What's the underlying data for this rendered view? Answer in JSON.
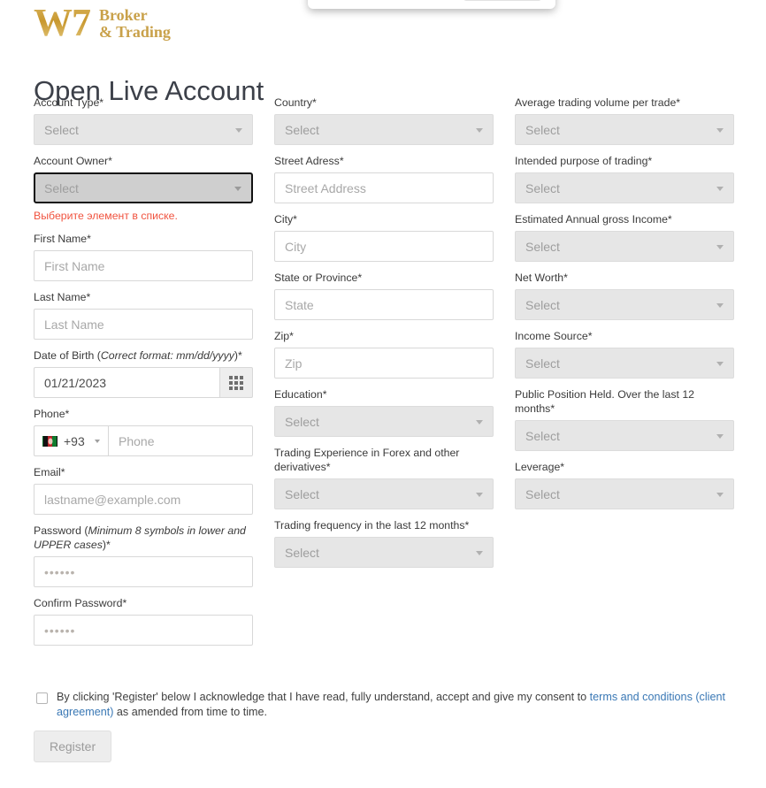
{
  "brand": {
    "mark": "W7",
    "word_line1": "Broker",
    "word_line2": "& Trading",
    "gold": "#c9a14a"
  },
  "page": {
    "title": "Open Live Account"
  },
  "colors": {
    "error": "#f0533f",
    "link": "#3a78b5",
    "select_bg": "#e6e6e6",
    "focus_border": "#111111"
  },
  "select_placeholder": "Select",
  "columns": {
    "left": [
      {
        "key": "account_type",
        "label": "Account Type*",
        "type": "select",
        "value": "Select"
      },
      {
        "key": "account_owner",
        "label": "Account Owner*",
        "type": "select",
        "value": "Select",
        "focused": true,
        "error": "Выберите элемент в списке."
      },
      {
        "key": "first_name",
        "label": "First Name*",
        "type": "text",
        "value": "",
        "placeholder": "First Name"
      },
      {
        "key": "last_name",
        "label": "Last Name*",
        "type": "text",
        "value": "",
        "placeholder": "Last Name"
      },
      {
        "key": "dob",
        "label_prefix": "Date of Birth (",
        "label_em": "Correct format: mm/dd/yyyy",
        "label_suffix": ")*",
        "type": "date",
        "value": "01/21/2023",
        "icon": "calendar-grid-icon"
      },
      {
        "key": "phone",
        "label": "Phone*",
        "type": "phone",
        "country_code": "+93",
        "flag": "afghanistan-flag",
        "value": "",
        "placeholder": "Phone"
      },
      {
        "key": "email",
        "label": "Email*",
        "type": "text",
        "value": "",
        "placeholder": "lastname@example.com"
      },
      {
        "key": "password",
        "label_prefix": "Password (",
        "label_em": "Minimum 8 symbols in lower and UPPER cases",
        "label_suffix": ")*",
        "type": "password",
        "value": "",
        "placeholder": "••••••"
      },
      {
        "key": "confirm_password",
        "label": "Confirm Password*",
        "type": "password",
        "value": "",
        "placeholder": "••••••"
      }
    ],
    "middle": [
      {
        "key": "country",
        "label": "Country*",
        "type": "select",
        "value": "Select"
      },
      {
        "key": "street",
        "label": "Street Adress*",
        "type": "text",
        "value": "",
        "placeholder": "Street Address"
      },
      {
        "key": "city",
        "label": "City*",
        "type": "text",
        "value": "",
        "placeholder": "City"
      },
      {
        "key": "state",
        "label": "State or Province*",
        "type": "text",
        "value": "",
        "placeholder": "State"
      },
      {
        "key": "zip",
        "label": "Zip*",
        "type": "text",
        "value": "",
        "placeholder": "Zip"
      },
      {
        "key": "education",
        "label": "Education*",
        "type": "select",
        "value": "Select"
      },
      {
        "key": "trading_experience",
        "label": "Trading Experience in Forex and other derivatives*",
        "type": "select",
        "value": "Select"
      },
      {
        "key": "trading_frequency",
        "label": "Trading frequency in the last 12 months*",
        "type": "select",
        "value": "Select"
      }
    ],
    "right": [
      {
        "key": "avg_volume",
        "label": "Average trading volume per trade*",
        "type": "select",
        "value": "Select"
      },
      {
        "key": "intended_purpose",
        "label": "Intended purpose of trading*",
        "type": "select",
        "value": "Select"
      },
      {
        "key": "annual_income",
        "label": "Estimated Annual gross Income*",
        "type": "select",
        "value": "Select"
      },
      {
        "key": "net_worth",
        "label": "Net Worth*",
        "type": "select",
        "value": "Select"
      },
      {
        "key": "income_source",
        "label": "Income Source*",
        "type": "select",
        "value": "Select"
      },
      {
        "key": "public_position",
        "label": "Public Position Held. Over the last 12 months*",
        "type": "select",
        "value": "Select"
      },
      {
        "key": "leverage",
        "label": "Leverage*",
        "type": "select",
        "value": "Select"
      }
    ]
  },
  "consent": {
    "checked": false,
    "text_before": "By clicking 'Register' below I acknowledge that I have read, fully understand, accept and give my consent to ",
    "link_text": "terms and conditions (client agreement)",
    "text_after": " as amended from time to time."
  },
  "register_label": "Register"
}
